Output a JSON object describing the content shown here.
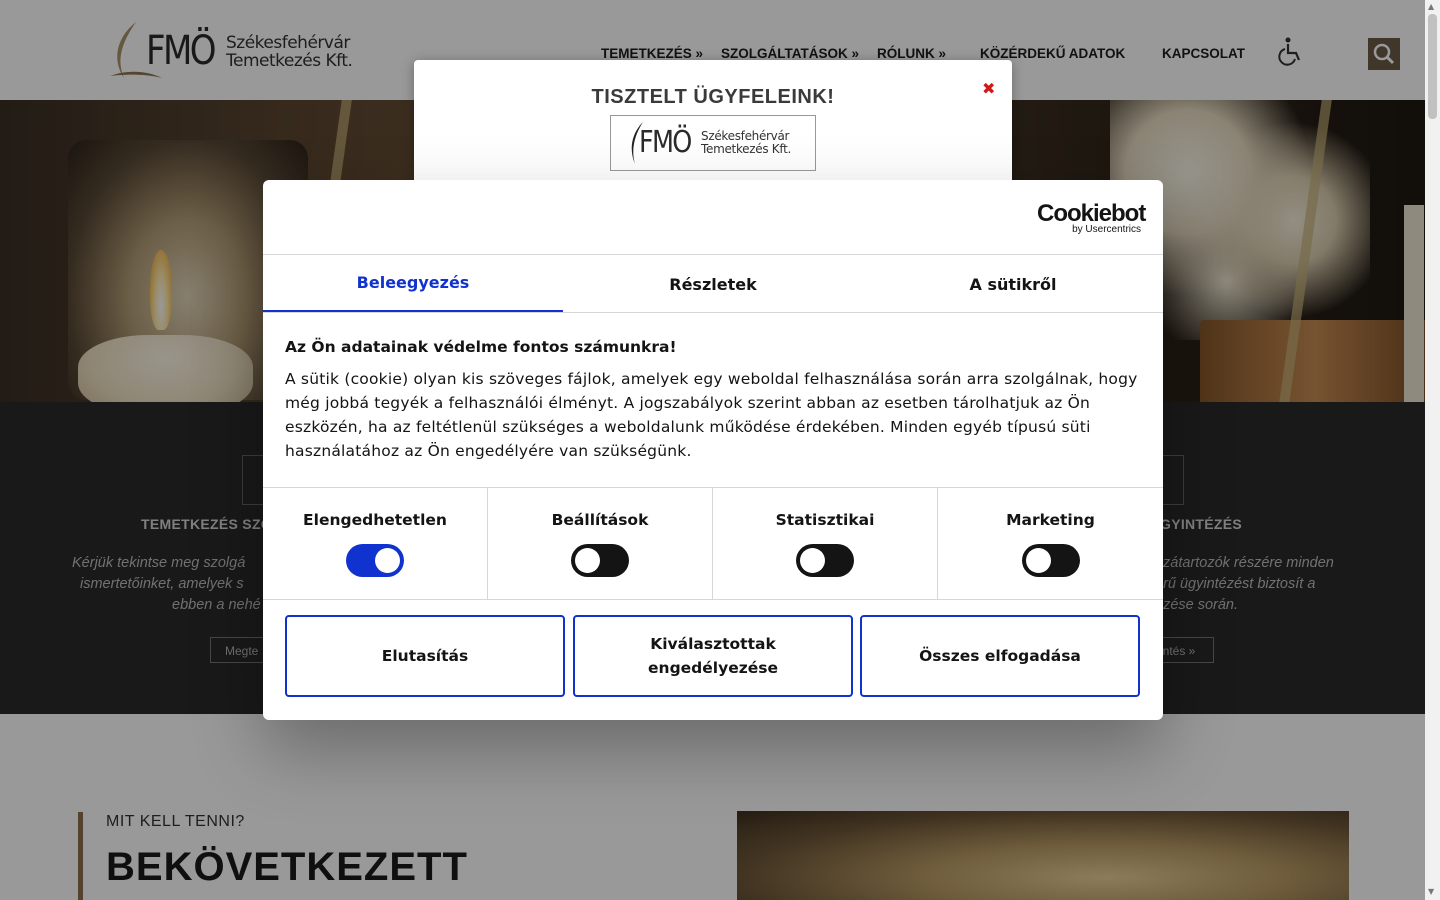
{
  "header": {
    "logo_mark": "FMÖ",
    "logo_company_line1": "Székesfehérvár",
    "logo_company_line2": "Temetkezés Kft.",
    "nav": [
      {
        "label": "TEMETKEZÉS »"
      },
      {
        "label": "SZOLGÁLTATÁSOK »"
      },
      {
        "label": "RÓLUNK »"
      },
      {
        "label": "KÖZÉRDEKŰ ADATOK"
      },
      {
        "label": "KAPCSOLAT"
      }
    ],
    "icons": {
      "accessibility": "wheelchair-icon",
      "search": "search-icon"
    },
    "accent_color": "#6b5a45"
  },
  "services": {
    "left": {
      "title": "TEMETKEZÉS SZO",
      "text_line1": "Kérjük tekintse meg szolgá",
      "text_line2": "ismertetőinket, amelyek s",
      "text_line3": "ebben a nehé",
      "button": "Megte"
    },
    "right": {
      "title": "GYINTÉZÉS",
      "text_line1": "zátartozók részére minden",
      "text_line2": "örű ügyintézést biztosít a",
      "text_line3": "ezése során.",
      "button": "intés »"
    }
  },
  "lower": {
    "kicker": "MIT KELL TENNI?",
    "title": "BEKÖVETKEZETT"
  },
  "notice": {
    "title": "TISZTELT ÜGYFELEINK!",
    "close_icon": "close-icon",
    "close_glyph": "✖",
    "logo_mark": "FMÖ",
    "logo_company_line1": "Székesfehérvár",
    "logo_company_line2": "Temetkezés Kft."
  },
  "cookie_dialog": {
    "brand_name": "Cookiebot",
    "brand_by": "by Usercentrics",
    "tabs": [
      {
        "label": "Beleegyezés",
        "active": true
      },
      {
        "label": "Részletek",
        "active": false
      },
      {
        "label": "A sütikről",
        "active": false
      }
    ],
    "heading": "Az Ön adatainak védelme fontos számunkra!",
    "body": "A sütik (cookie) olyan kis szöveges fájlok, amelyek egy weboldal felhasználása során arra szolgálnak, hogy még jobbá tegyék a felhasználói élményt. A jogszabályok szerint abban az esetben tárolhatjuk az Ön eszközén, ha az feltétlenül szükséges a weboldalunk működése érdekében. Minden egyéb típusú süti használatához az Ön engedélyére van szükségünk.",
    "categories": [
      {
        "label": "Elengedhetetlen",
        "enabled": true
      },
      {
        "label": "Beállítások",
        "enabled": false
      },
      {
        "label": "Statisztikai",
        "enabled": false
      },
      {
        "label": "Marketing",
        "enabled": false
      }
    ],
    "buttons": {
      "reject": "Elutasítás",
      "allow_selected": "Kiválasztottak engedélyezése",
      "accept_all": "Összes elfogadása"
    },
    "accent_color": "#1032cf"
  }
}
